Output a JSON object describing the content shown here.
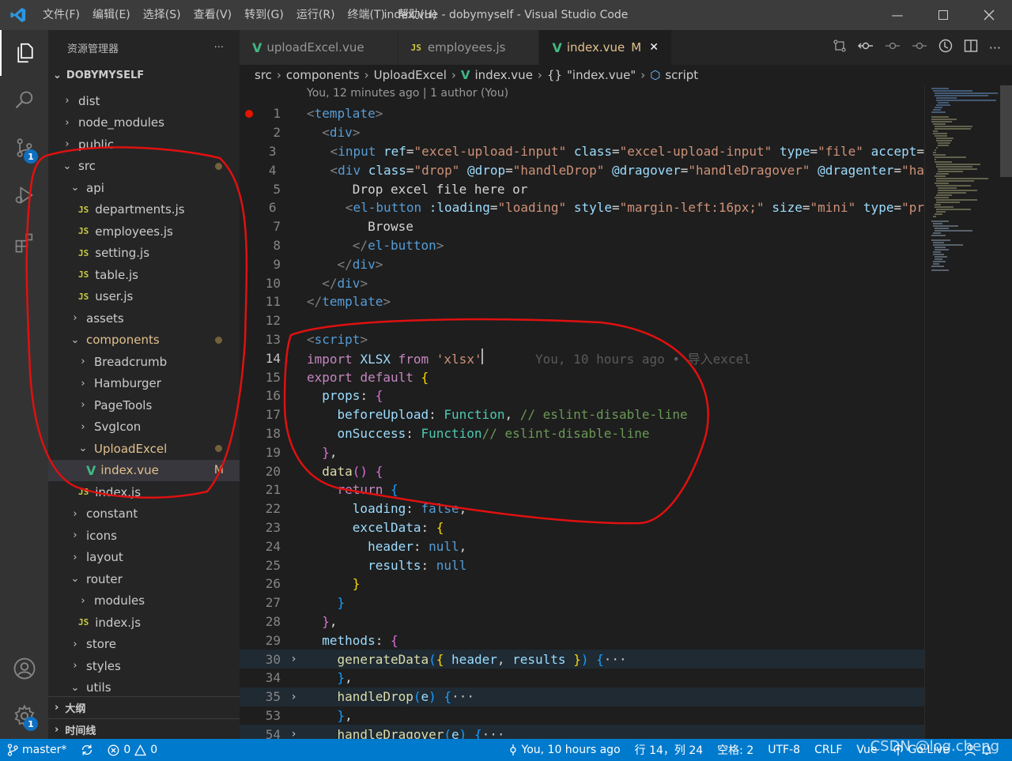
{
  "window": {
    "title": "index.vue - dobymyself - Visual Studio Code",
    "menu": [
      "文件(F)",
      "编辑(E)",
      "选择(S)",
      "查看(V)",
      "转到(G)",
      "运行(R)",
      "终端(T)",
      "帮助(H)"
    ]
  },
  "activity": {
    "scm_badge": "1",
    "settings_badge": "1"
  },
  "sidebar": {
    "title": "资源管理器",
    "more": "···",
    "root": "DOBYMYSELF",
    "tree": [
      {
        "label": "dist",
        "type": "folder",
        "depth": 0,
        "open": false
      },
      {
        "label": "node_modules",
        "type": "folder",
        "depth": 0,
        "open": false
      },
      {
        "label": "public",
        "type": "folder",
        "depth": 0,
        "open": false
      },
      {
        "label": "src",
        "type": "folder",
        "depth": 0,
        "open": true,
        "dot": true
      },
      {
        "label": "api",
        "type": "folder",
        "depth": 1,
        "open": true
      },
      {
        "label": "departments.js",
        "type": "js",
        "depth": 2
      },
      {
        "label": "employees.js",
        "type": "js",
        "depth": 2
      },
      {
        "label": "setting.js",
        "type": "js",
        "depth": 2
      },
      {
        "label": "table.js",
        "type": "js",
        "depth": 2
      },
      {
        "label": "user.js",
        "type": "js",
        "depth": 2
      },
      {
        "label": "assets",
        "type": "folder",
        "depth": 1,
        "open": false
      },
      {
        "label": "components",
        "type": "folder",
        "depth": 1,
        "open": true,
        "dot": true,
        "modified": true
      },
      {
        "label": "Breadcrumb",
        "type": "folder",
        "depth": 2,
        "open": false
      },
      {
        "label": "Hamburger",
        "type": "folder",
        "depth": 2,
        "open": false
      },
      {
        "label": "PageTools",
        "type": "folder",
        "depth": 2,
        "open": false
      },
      {
        "label": "SvgIcon",
        "type": "folder",
        "depth": 2,
        "open": false
      },
      {
        "label": "UploadExcel",
        "type": "folder",
        "depth": 2,
        "open": true,
        "dot": true,
        "modified": true
      },
      {
        "label": "index.vue",
        "type": "vue",
        "depth": 3,
        "selected": true,
        "modified": true,
        "status": "M"
      },
      {
        "label": "index.js",
        "type": "js",
        "depth": 2
      },
      {
        "label": "constant",
        "type": "folder",
        "depth": 1,
        "open": false
      },
      {
        "label": "icons",
        "type": "folder",
        "depth": 1,
        "open": false
      },
      {
        "label": "layout",
        "type": "folder",
        "depth": 1,
        "open": false
      },
      {
        "label": "router",
        "type": "folder",
        "depth": 1,
        "open": true
      },
      {
        "label": "modules",
        "type": "folder",
        "depth": 2,
        "open": false
      },
      {
        "label": "index.js",
        "type": "js",
        "depth": 2
      },
      {
        "label": "store",
        "type": "folder",
        "depth": 1,
        "open": false
      },
      {
        "label": "styles",
        "type": "folder",
        "depth": 1,
        "open": false
      },
      {
        "label": "utils",
        "type": "folder",
        "depth": 1,
        "open": true
      }
    ],
    "outline": "大纲",
    "timeline": "时间线"
  },
  "tabs": [
    {
      "label": "uploadExcel.vue",
      "type": "vue",
      "active": false
    },
    {
      "label": "employees.js",
      "type": "js",
      "active": false
    },
    {
      "label": "index.vue",
      "type": "vue",
      "active": true,
      "status": "M"
    }
  ],
  "breadcrumbs": [
    "src",
    "components",
    "UploadExcel",
    "index.vue",
    "\"index.vue\"",
    "script"
  ],
  "codelens": "You, 12 minutes ago | 1 author (You)",
  "code": [
    {
      "n": "1",
      "segs": [
        [
          "t-punc",
          "<"
        ],
        [
          "t-tag",
          "template"
        ],
        [
          "t-punc",
          ">"
        ]
      ]
    },
    {
      "n": "2",
      "segs": [
        [
          "",
          "  "
        ],
        [
          "t-punc",
          "<"
        ],
        [
          "t-tag",
          "div"
        ],
        [
          "t-punc",
          ">"
        ]
      ]
    },
    {
      "n": "3",
      "segs": [
        [
          "",
          "    "
        ],
        [
          "t-punc",
          "<"
        ],
        [
          "t-tag",
          "input"
        ],
        [
          "",
          " "
        ],
        [
          "t-attr",
          "ref"
        ],
        [
          "",
          "="
        ],
        [
          "t-str",
          "\"excel-upload-input\""
        ],
        [
          "",
          " "
        ],
        [
          "t-attr",
          "class"
        ],
        [
          "",
          "="
        ],
        [
          "t-str",
          "\"excel-upload-input\""
        ],
        [
          "",
          " "
        ],
        [
          "t-attr",
          "type"
        ],
        [
          "",
          "="
        ],
        [
          "t-str",
          "\"file\""
        ],
        [
          "",
          " "
        ],
        [
          "t-attr",
          "accept"
        ],
        [
          "",
          "="
        ]
      ]
    },
    {
      "n": "4",
      "segs": [
        [
          "",
          "    "
        ],
        [
          "t-punc",
          "<"
        ],
        [
          "t-tag",
          "div"
        ],
        [
          "",
          " "
        ],
        [
          "t-attr",
          "class"
        ],
        [
          "",
          "="
        ],
        [
          "t-str",
          "\"drop\""
        ],
        [
          "",
          " "
        ],
        [
          "t-attr",
          "@drop"
        ],
        [
          "",
          "="
        ],
        [
          "t-str",
          "\"handleDrop\""
        ],
        [
          "",
          " "
        ],
        [
          "t-attr",
          "@dragover"
        ],
        [
          "",
          "="
        ],
        [
          "t-str",
          "\"handleDragover\""
        ],
        [
          "",
          " "
        ],
        [
          "t-attr",
          "@dragenter"
        ],
        [
          "",
          "="
        ],
        [
          "t-str",
          "\"ha"
        ]
      ]
    },
    {
      "n": "5",
      "segs": [
        [
          "",
          "      Drop excel file here or"
        ]
      ]
    },
    {
      "n": "6",
      "segs": [
        [
          "",
          "      "
        ],
        [
          "t-punc",
          "<"
        ],
        [
          "t-tag",
          "el-button"
        ],
        [
          "",
          " "
        ],
        [
          "t-attr",
          ":loading"
        ],
        [
          "",
          "="
        ],
        [
          "t-str",
          "\"loading\""
        ],
        [
          "",
          " "
        ],
        [
          "t-attr",
          "style"
        ],
        [
          "",
          "="
        ],
        [
          "t-str",
          "\"margin-left:16px;\""
        ],
        [
          "",
          " "
        ],
        [
          "t-attr",
          "size"
        ],
        [
          "",
          "="
        ],
        [
          "t-str",
          "\"mini\""
        ],
        [
          "",
          " "
        ],
        [
          "t-attr",
          "type"
        ],
        [
          "",
          "="
        ],
        [
          "t-str",
          "\"pr"
        ]
      ]
    },
    {
      "n": "7",
      "segs": [
        [
          "",
          "        Browse"
        ]
      ]
    },
    {
      "n": "8",
      "segs": [
        [
          "",
          "      "
        ],
        [
          "t-punc",
          "</"
        ],
        [
          "t-tag",
          "el-button"
        ],
        [
          "t-punc",
          ">"
        ]
      ]
    },
    {
      "n": "9",
      "segs": [
        [
          "",
          "    "
        ],
        [
          "t-punc",
          "</"
        ],
        [
          "t-tag",
          "div"
        ],
        [
          "t-punc",
          ">"
        ]
      ]
    },
    {
      "n": "10",
      "segs": [
        [
          "",
          "  "
        ],
        [
          "t-punc",
          "</"
        ],
        [
          "t-tag",
          "div"
        ],
        [
          "t-punc",
          ">"
        ]
      ]
    },
    {
      "n": "11",
      "segs": [
        [
          "t-punc",
          "</"
        ],
        [
          "t-tag",
          "template"
        ],
        [
          "t-punc",
          ">"
        ]
      ]
    },
    {
      "n": "12",
      "segs": []
    },
    {
      "n": "13",
      "segs": [
        [
          "t-punc",
          "<"
        ],
        [
          "t-tag",
          "script"
        ],
        [
          "t-punc",
          ">"
        ]
      ]
    },
    {
      "n": "14",
      "cur": true,
      "segs": [
        [
          "t-kw",
          "import"
        ],
        [
          "",
          " "
        ],
        [
          "t-prop",
          "XLSX"
        ],
        [
          "",
          " "
        ],
        [
          "t-kw",
          "from"
        ],
        [
          "",
          " "
        ],
        [
          "t-str",
          "'xlsx'"
        ],
        [
          "",
          "       "
        ],
        [
          "t-blame",
          "You, 10 hours ago • 导入excel"
        ]
      ]
    },
    {
      "n": "15",
      "segs": [
        [
          "t-kw",
          "export"
        ],
        [
          "",
          " "
        ],
        [
          "t-kw",
          "default"
        ],
        [
          "",
          " "
        ],
        [
          "t-br1",
          "{"
        ]
      ]
    },
    {
      "n": "16",
      "segs": [
        [
          "",
          "  "
        ],
        [
          "t-prop",
          "props"
        ],
        [
          "",
          ": "
        ],
        [
          "t-br2",
          "{"
        ]
      ]
    },
    {
      "n": "17",
      "segs": [
        [
          "",
          "    "
        ],
        [
          "t-prop",
          "beforeUpload"
        ],
        [
          "",
          ": "
        ],
        [
          "t-type",
          "Function"
        ],
        [
          "",
          ", "
        ],
        [
          "t-com",
          "// eslint-disable-line"
        ]
      ]
    },
    {
      "n": "18",
      "segs": [
        [
          "",
          "    "
        ],
        [
          "t-prop",
          "onSuccess"
        ],
        [
          "",
          ": "
        ],
        [
          "t-type",
          "Function"
        ],
        [
          "t-com",
          "// eslint-disable-line"
        ]
      ]
    },
    {
      "n": "19",
      "segs": [
        [
          "",
          "  "
        ],
        [
          "t-br2",
          "}"
        ],
        [
          "",
          ","
        ]
      ]
    },
    {
      "n": "20",
      "segs": [
        [
          "",
          "  "
        ],
        [
          "t-fn",
          "data"
        ],
        [
          "t-br2",
          "()"
        ],
        [
          "",
          " "
        ],
        [
          "t-br2",
          "{"
        ]
      ]
    },
    {
      "n": "21",
      "segs": [
        [
          "",
          "    "
        ],
        [
          "t-kw",
          "return"
        ],
        [
          "",
          " "
        ],
        [
          "t-br3",
          "{"
        ]
      ]
    },
    {
      "n": "22",
      "segs": [
        [
          "",
          "      "
        ],
        [
          "t-prop",
          "loading"
        ],
        [
          "",
          ": "
        ],
        [
          "t-const",
          "false"
        ],
        [
          "",
          ","
        ]
      ]
    },
    {
      "n": "23",
      "segs": [
        [
          "",
          "      "
        ],
        [
          "t-prop",
          "excelData"
        ],
        [
          "",
          ": "
        ],
        [
          "t-br1",
          "{"
        ]
      ]
    },
    {
      "n": "24",
      "segs": [
        [
          "",
          "        "
        ],
        [
          "t-prop",
          "header"
        ],
        [
          "",
          ": "
        ],
        [
          "t-const",
          "null"
        ],
        [
          "",
          ","
        ]
      ]
    },
    {
      "n": "25",
      "segs": [
        [
          "",
          "        "
        ],
        [
          "t-prop",
          "results"
        ],
        [
          "",
          ": "
        ],
        [
          "t-const",
          "null"
        ]
      ]
    },
    {
      "n": "26",
      "segs": [
        [
          "",
          "      "
        ],
        [
          "t-br1",
          "}"
        ]
      ]
    },
    {
      "n": "27",
      "segs": [
        [
          "",
          "    "
        ],
        [
          "t-br3",
          "}"
        ]
      ]
    },
    {
      "n": "28",
      "segs": [
        [
          "",
          "  "
        ],
        [
          "t-br2",
          "}"
        ],
        [
          "",
          ","
        ]
      ]
    },
    {
      "n": "29",
      "segs": [
        [
          "",
          "  "
        ],
        [
          "t-prop",
          "methods"
        ],
        [
          "",
          ": "
        ],
        [
          "t-br2",
          "{"
        ]
      ]
    },
    {
      "n": "30",
      "fold": true,
      "hl": true,
      "segs": [
        [
          "",
          "    "
        ],
        [
          "t-fn",
          "generateData"
        ],
        [
          "t-br3",
          "("
        ],
        [
          "t-br1",
          "{"
        ],
        [
          "",
          " "
        ],
        [
          "t-prop",
          "header"
        ],
        [
          "",
          ", "
        ],
        [
          "t-prop",
          "results"
        ],
        [
          "",
          " "
        ],
        [
          "t-br1",
          "}"
        ],
        [
          "t-br3",
          ")"
        ],
        [
          "",
          " "
        ],
        [
          "t-br3",
          "{"
        ],
        [
          "t-fold",
          "···"
        ]
      ]
    },
    {
      "n": "34",
      "segs": [
        [
          "",
          "    "
        ],
        [
          "t-br3",
          "}"
        ],
        [
          "",
          ","
        ]
      ]
    },
    {
      "n": "35",
      "fold": true,
      "hl": true,
      "segs": [
        [
          "",
          "    "
        ],
        [
          "t-fn",
          "handleDrop"
        ],
        [
          "t-br3",
          "("
        ],
        [
          "t-prop",
          "e"
        ],
        [
          "t-br3",
          ")"
        ],
        [
          "",
          " "
        ],
        [
          "t-br3",
          "{"
        ],
        [
          "t-fold",
          "···"
        ]
      ]
    },
    {
      "n": "53",
      "segs": [
        [
          "",
          "    "
        ],
        [
          "t-br3",
          "}"
        ],
        [
          "",
          ","
        ]
      ]
    },
    {
      "n": "54",
      "fold": true,
      "hl": true,
      "segs": [
        [
          "",
          "    "
        ],
        [
          "t-fn",
          "handleDragover"
        ],
        [
          "t-br3",
          "("
        ],
        [
          "t-prop",
          "e"
        ],
        [
          "t-br3",
          ")"
        ],
        [
          "",
          " "
        ],
        [
          "t-br3",
          "{"
        ],
        [
          "t-fold",
          "···"
        ]
      ]
    }
  ],
  "status": {
    "branch": "master*",
    "errors": "0",
    "warnings": "0",
    "blame": "You, 10 hours ago",
    "position": "行 14，列 24",
    "spaces": "空格: 2",
    "encoding": "UTF-8",
    "eol": "CRLF",
    "language": "Vue",
    "golive": "Go Live"
  },
  "watermark": "CSDN @log.cheng",
  "colors": {
    "accent": "#007acc",
    "annotation": "#e01010",
    "breakpoint": "#e51400"
  }
}
